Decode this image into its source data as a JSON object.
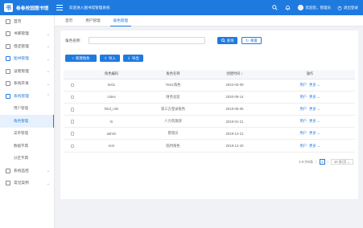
{
  "app": {
    "logo_text": "卷卷校园图书馆",
    "system_title": "欢迎进入图书馆管理系统",
    "user_name": "欢迎您，管理员",
    "logout_label": "退出登录"
  },
  "sidebar": {
    "items": [
      {
        "label": "首页"
      },
      {
        "label": "书库管理"
      },
      {
        "label": "借还管理"
      },
      {
        "label": "图书管理"
      },
      {
        "label": "读者管理"
      },
      {
        "label": "系统开发"
      },
      {
        "label": "系统管理"
      }
    ],
    "submenu": [
      {
        "label": "用户管理"
      },
      {
        "label": "角色管理"
      },
      {
        "label": "菜单管理"
      },
      {
        "label": "数据字典"
      },
      {
        "label": "分区字典"
      }
    ],
    "bottom_items": [
      {
        "label": "系统监控"
      },
      {
        "label": "常见案例"
      }
    ]
  },
  "tabs": [
    {
      "label": "首页"
    },
    {
      "label": "用户管理"
    },
    {
      "label": "角色管理"
    }
  ],
  "search": {
    "label": "角色名称:",
    "value": "",
    "query_label": "查询",
    "reset_label": "重置"
  },
  "actions": {
    "add_label": "新建角色",
    "import_label": "导入",
    "export_label": "导出"
  },
  "table": {
    "headers": [
      "角色编码",
      "角色名称",
      "创建时间 ↕",
      "操作"
    ],
    "rows": [
      {
        "key": "test1",
        "name": "Test1角色",
        "time": "2022-03-09"
      },
      {
        "key": "cates",
        "name": "财务总监",
        "time": "2020-09-14"
      },
      {
        "key": "third_role",
        "name": "第三方登录角色",
        "time": "2019-05-05"
      },
      {
        "key": "hr",
        "name": "人力资源部",
        "time": "2019-01-21"
      },
      {
        "key": "admin",
        "name": "管理员",
        "time": "2018-12-21"
      },
      {
        "key": "test",
        "name": "临时角色",
        "time": "2018-12-20"
      }
    ],
    "op_user": "用户",
    "op_more": "更多 ⌄"
  },
  "pagination": {
    "summary": "1-6 共6条",
    "prev": "‹",
    "current": "1",
    "next": "›",
    "page_size": "10 条/页 ⌄"
  },
  "colors": {
    "primary": "#1f7ae0",
    "page_bg": "#f0f2f5"
  }
}
